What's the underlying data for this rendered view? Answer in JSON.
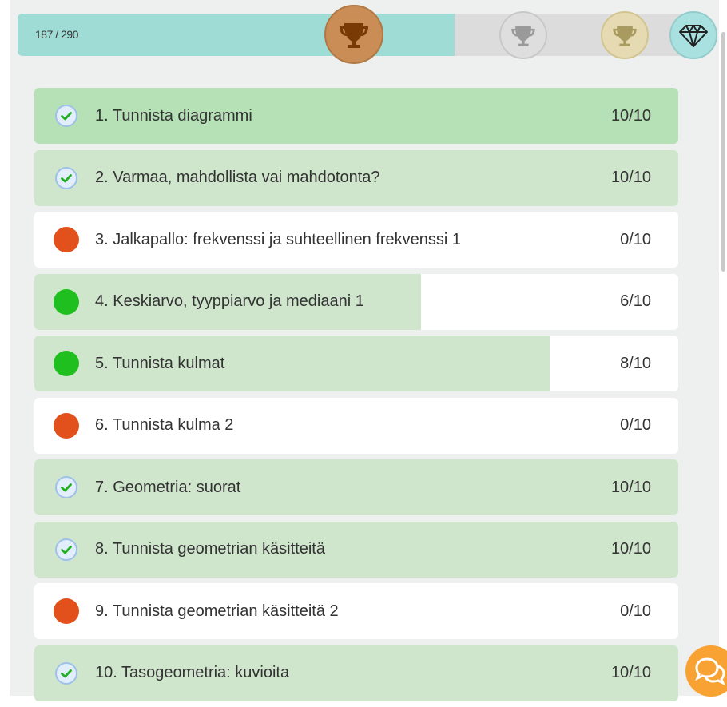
{
  "progress": {
    "text": "187 / 290",
    "fraction": 0.6448
  },
  "trophies": [
    {
      "name": "bronze",
      "color": "#c98d55",
      "icon": "trophy-icon",
      "earned": true
    },
    {
      "name": "silver",
      "color": "#dedede",
      "icon": "trophy-icon",
      "earned": false
    },
    {
      "name": "gold",
      "color": "#e6dab2",
      "icon": "trophy-icon",
      "earned": false
    },
    {
      "name": "diamond",
      "color": "#a9e0e0",
      "icon": "diamond-icon",
      "earned": false
    }
  ],
  "exercises": [
    {
      "title": "1. Tunnista diagrammi",
      "score": "10/10",
      "status": "done",
      "progress": 1.0
    },
    {
      "title": "2. Varmaa, mahdollista vai mahdotonta?",
      "score": "10/10",
      "status": "done",
      "progress": 1.0
    },
    {
      "title": "3. Jalkapallo: frekvenssi ja suhteellinen frekvenssi 1",
      "score": "0/10",
      "status": "none",
      "progress": 0.0
    },
    {
      "title": "4. Keskiarvo, tyyppiarvo ja mediaani 1",
      "score": "6/10",
      "status": "started",
      "progress": 0.6
    },
    {
      "title": "5. Tunnista kulmat",
      "score": "8/10",
      "status": "started",
      "progress": 0.8
    },
    {
      "title": "6. Tunnista kulma 2",
      "score": "0/10",
      "status": "none",
      "progress": 0.0
    },
    {
      "title": "7. Geometria: suorat",
      "score": "10/10",
      "status": "done",
      "progress": 1.0
    },
    {
      "title": "8. Tunnista geometrian käsitteitä",
      "score": "10/10",
      "status": "done",
      "progress": 1.0
    },
    {
      "title": "9. Tunnista geometrian käsitteitä 2",
      "score": "0/10",
      "status": "none",
      "progress": 0.0
    },
    {
      "title": "10. Tasogeometria: kuvioita",
      "score": "10/10",
      "status": "done",
      "progress": 1.0
    }
  ],
  "colors": {
    "done_fill": "#cfe6cd",
    "started_dot": "#1fbf1f",
    "none_dot": "#e2511b",
    "check": "#22b022",
    "chat": "#f7a233"
  },
  "chat": {
    "icon": "chat-bubbles-icon"
  }
}
